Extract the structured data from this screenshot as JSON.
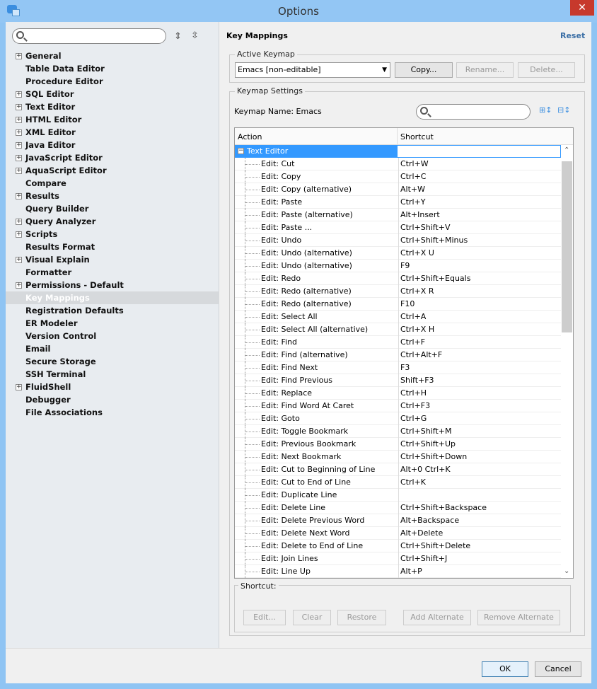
{
  "window": {
    "title": "Options",
    "close": "✕"
  },
  "sidebar": {
    "items": [
      {
        "label": "General",
        "expandable": true
      },
      {
        "label": "Table Data Editor"
      },
      {
        "label": "Procedure Editor"
      },
      {
        "label": "SQL Editor",
        "expandable": true
      },
      {
        "label": "Text Editor",
        "expandable": true
      },
      {
        "label": "HTML Editor",
        "expandable": true
      },
      {
        "label": "XML Editor",
        "expandable": true
      },
      {
        "label": "Java Editor",
        "expandable": true
      },
      {
        "label": "JavaScript Editor",
        "expandable": true
      },
      {
        "label": "AquaScript Editor",
        "expandable": true
      },
      {
        "label": "Compare"
      },
      {
        "label": "Results",
        "expandable": true
      },
      {
        "label": "Query Builder"
      },
      {
        "label": "Query Analyzer",
        "expandable": true
      },
      {
        "label": "Scripts",
        "expandable": true
      },
      {
        "label": "Results Format"
      },
      {
        "label": "Visual Explain",
        "expandable": true
      },
      {
        "label": "Formatter"
      },
      {
        "label": "Permissions - Default",
        "expandable": true
      },
      {
        "label": "Key Mappings",
        "selected": true
      },
      {
        "label": "Registration Defaults"
      },
      {
        "label": "ER Modeler"
      },
      {
        "label": "Version Control"
      },
      {
        "label": "Email"
      },
      {
        "label": "Secure Storage"
      },
      {
        "label": "SSH Terminal"
      },
      {
        "label": "FluidShell",
        "expandable": true
      },
      {
        "label": "Debugger"
      },
      {
        "label": "File Associations"
      }
    ]
  },
  "main": {
    "title": "Key Mappings",
    "reset": "Reset",
    "active_keymap": {
      "legend": "Active Keymap",
      "selected": "Emacs [non-editable]",
      "copy": "Copy...",
      "rename": "Rename...",
      "delete": "Delete..."
    },
    "settings": {
      "legend": "Keymap Settings",
      "name_label": "Keymap Name: Emacs"
    },
    "table": {
      "col_action": "Action",
      "col_shortcut": "Shortcut",
      "group": "Text Editor",
      "rows": [
        [
          "Edit: Cut",
          "Ctrl+W"
        ],
        [
          "Edit: Copy",
          "Ctrl+C"
        ],
        [
          "Edit: Copy (alternative)",
          "Alt+W"
        ],
        [
          "Edit: Paste",
          "Ctrl+Y"
        ],
        [
          "Edit: Paste (alternative)",
          "Alt+Insert"
        ],
        [
          "Edit: Paste ...",
          "Ctrl+Shift+V"
        ],
        [
          "Edit: Undo",
          "Ctrl+Shift+Minus"
        ],
        [
          "Edit: Undo (alternative)",
          "Ctrl+X U"
        ],
        [
          "Edit: Undo (alternative)",
          "F9"
        ],
        [
          "Edit: Redo",
          "Ctrl+Shift+Equals"
        ],
        [
          "Edit: Redo (alternative)",
          "Ctrl+X R"
        ],
        [
          "Edit: Redo (alternative)",
          "F10"
        ],
        [
          "Edit: Select All",
          "Ctrl+A"
        ],
        [
          "Edit: Select All (alternative)",
          "Ctrl+X H"
        ],
        [
          "Edit: Find",
          "Ctrl+F"
        ],
        [
          "Edit: Find (alternative)",
          "Ctrl+Alt+F"
        ],
        [
          "Edit: Find Next",
          "F3"
        ],
        [
          "Edit: Find Previous",
          "Shift+F3"
        ],
        [
          "Edit: Replace",
          "Ctrl+H"
        ],
        [
          "Edit: Find Word At Caret",
          "Ctrl+F3"
        ],
        [
          "Edit: Goto",
          "Ctrl+G"
        ],
        [
          "Edit: Toggle Bookmark",
          "Ctrl+Shift+M"
        ],
        [
          "Edit: Previous Bookmark",
          "Ctrl+Shift+Up"
        ],
        [
          "Edit: Next Bookmark",
          "Ctrl+Shift+Down"
        ],
        [
          "Edit: Cut to Beginning of Line",
          "Alt+0 Ctrl+K"
        ],
        [
          "Edit: Cut to End of Line",
          "Ctrl+K"
        ],
        [
          "Edit: Duplicate Line",
          ""
        ],
        [
          "Edit: Delete Line",
          "Ctrl+Shift+Backspace"
        ],
        [
          "Edit: Delete Previous Word",
          "Alt+Backspace"
        ],
        [
          "Edit: Delete Next Word",
          "Alt+Delete"
        ],
        [
          "Edit: Delete to End of Line",
          "Ctrl+Shift+Delete"
        ],
        [
          "Edit: Join Lines",
          "Ctrl+Shift+J"
        ],
        [
          "Edit: Line Up",
          "Alt+P"
        ]
      ]
    },
    "shortcut": {
      "legend": "Shortcut:",
      "edit": "Edit...",
      "clear": "Clear",
      "restore": "Restore",
      "add_alt": "Add Alternate",
      "remove_alt": "Remove Alternate"
    }
  },
  "footer": {
    "ok": "OK",
    "cancel": "Cancel"
  },
  "colors": {
    "selection": "#3399ff",
    "titlebar": "#93c6f4"
  }
}
